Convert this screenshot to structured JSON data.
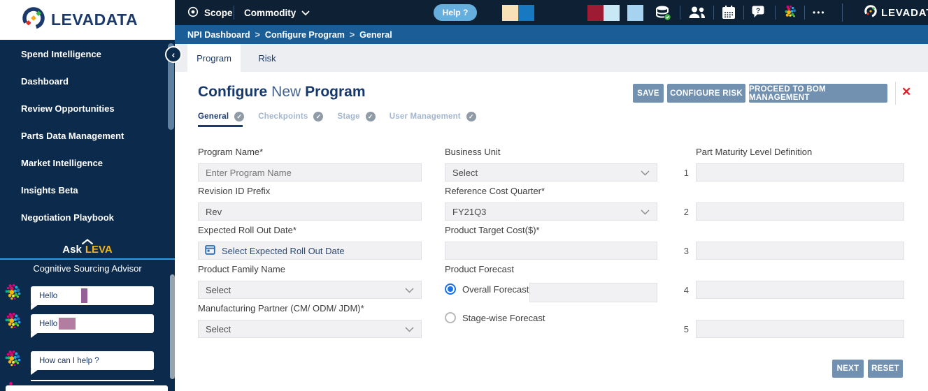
{
  "brand": {
    "name": "LEVADATA"
  },
  "topbar": {
    "scope_label": "Scope",
    "commodity_label": "Commodity",
    "help_label": "Help ?",
    "ellipsis": "•••",
    "brand": "LEVADATA"
  },
  "breadcrumb": {
    "items": [
      "NPI Dashboard",
      "Configure Program",
      "General"
    ],
    "separator": ">"
  },
  "tabs": {
    "program": "Program",
    "risk": "Risk"
  },
  "sidebar": {
    "items": [
      {
        "label": "Spend Intelligence"
      },
      {
        "label": "Dashboard"
      },
      {
        "label": "Review Opportunities"
      },
      {
        "label": "Parts Data Management"
      },
      {
        "label": "Market Intelligence"
      },
      {
        "label": "Insights Beta"
      },
      {
        "label": "Negotiation Playbook"
      }
    ],
    "ask_leva": {
      "ask": "Ask",
      "leva": "LEVA",
      "subtitle": "Cognitive Sourcing Advisor",
      "messages": [
        {
          "text": "Hello"
        },
        {
          "text": "Hello"
        },
        {
          "text": "How can I help ?"
        }
      ]
    }
  },
  "page": {
    "title_parts": [
      "Configure",
      "New",
      "Program"
    ],
    "steps": [
      {
        "label": "General"
      },
      {
        "label": "Checkpoints"
      },
      {
        "label": "Stage"
      },
      {
        "label": "User Management"
      }
    ]
  },
  "actions": {
    "save": "SAVE",
    "configure_risk": "CONFIGURE RISK",
    "proceed_bom": "PROCEED TO BOM MANAGEMENT",
    "next": "NEXT",
    "reset": "RESET"
  },
  "form": {
    "program_name": {
      "label": "Program Name*",
      "placeholder": "Enter Program Name"
    },
    "revision_id_prefix": {
      "label": "Revision ID Prefix",
      "value": "Rev"
    },
    "expected_roll_out_date": {
      "label": "Expected Roll Out Date*",
      "placeholder": "Select Expected Roll Out Date"
    },
    "product_family_name": {
      "label": "Product Family Name",
      "value": "Select"
    },
    "manufacturing_partner": {
      "label": "Manufacturing Partner (CM/ ODM/ JDM)*",
      "value": "Select"
    },
    "business_unit": {
      "label": "Business Unit",
      "value": "Select"
    },
    "reference_cost_quarter": {
      "label": "Reference Cost Quarter*",
      "value": "FY21Q3"
    },
    "product_target_cost": {
      "label": "Product Target Cost($)*",
      "value": ""
    },
    "product_forecast": {
      "label": "Product Forecast",
      "overall": {
        "label": "Overall Forecast*",
        "selected": true
      },
      "stage_wise": {
        "label": "Stage-wise Forecast",
        "selected": false
      }
    },
    "part_maturity": {
      "label": "Part Maturity Level Definition",
      "rows": [
        "1",
        "2",
        "3",
        "4",
        "5"
      ]
    }
  },
  "icons": {
    "check": "✓",
    "collapse": "‹",
    "close": "✕"
  },
  "colors": {
    "topbar": "#0e2134",
    "sidebar": "#0c2a4b",
    "breadcrumb": "#1b5d97",
    "action_button": "#7291b0",
    "help_pill": "#66aedd",
    "leva_yellow": "#f0b41e",
    "radio_blue": "#1a73e8",
    "close_red": "#e51e2a"
  }
}
